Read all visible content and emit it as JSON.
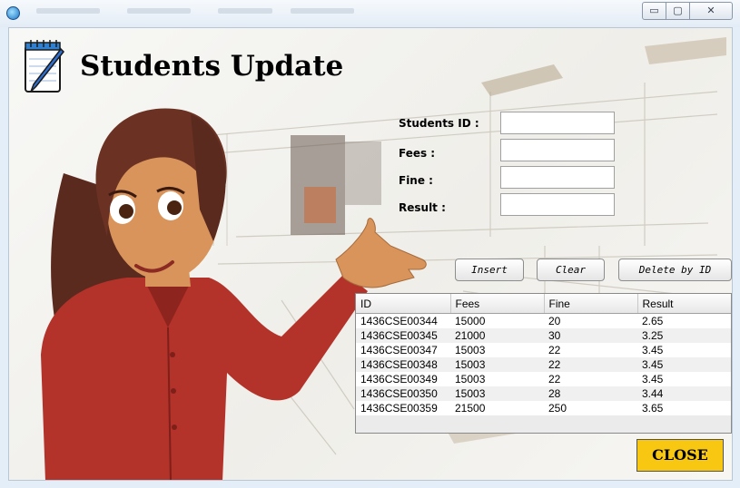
{
  "window": {
    "controls": {
      "minimize": "▭",
      "maximize": "▢",
      "close": "✕"
    }
  },
  "form": {
    "title": "Students Update",
    "labels": {
      "student_id": "Students ID :",
      "fees": "Fees :",
      "fine": "Fine :",
      "result": "Result :"
    },
    "values": {
      "student_id": "",
      "fees": "",
      "fine": "",
      "result": ""
    }
  },
  "buttons": {
    "insert": "Insert",
    "clear": "Clear",
    "delete_by_id": "Delete by ID",
    "close": "CLOSE"
  },
  "table": {
    "columns": [
      "ID",
      "Fees",
      "Fine",
      "Result"
    ],
    "rows": [
      [
        "1436CSE00344",
        "15000",
        "20",
        "2.65"
      ],
      [
        "1436CSE00345",
        "21000",
        "30",
        "3.25"
      ],
      [
        "1436CSE00347",
        "15003",
        "22",
        "3.45"
      ],
      [
        "1436CSE00348",
        "15003",
        "22",
        "3.45"
      ],
      [
        "1436CSE00349",
        "15003",
        "22",
        "3.45"
      ],
      [
        "1436CSE00350",
        "15003",
        "28",
        "3.44"
      ],
      [
        "1436CSE00359",
        "21500",
        "250",
        "3.65"
      ]
    ]
  },
  "icons": {
    "app": "app-icon",
    "notepad": "notepad-pencil-icon"
  },
  "colors": {
    "close_button": "#f7c711",
    "window_frame": "#e4eef8"
  }
}
